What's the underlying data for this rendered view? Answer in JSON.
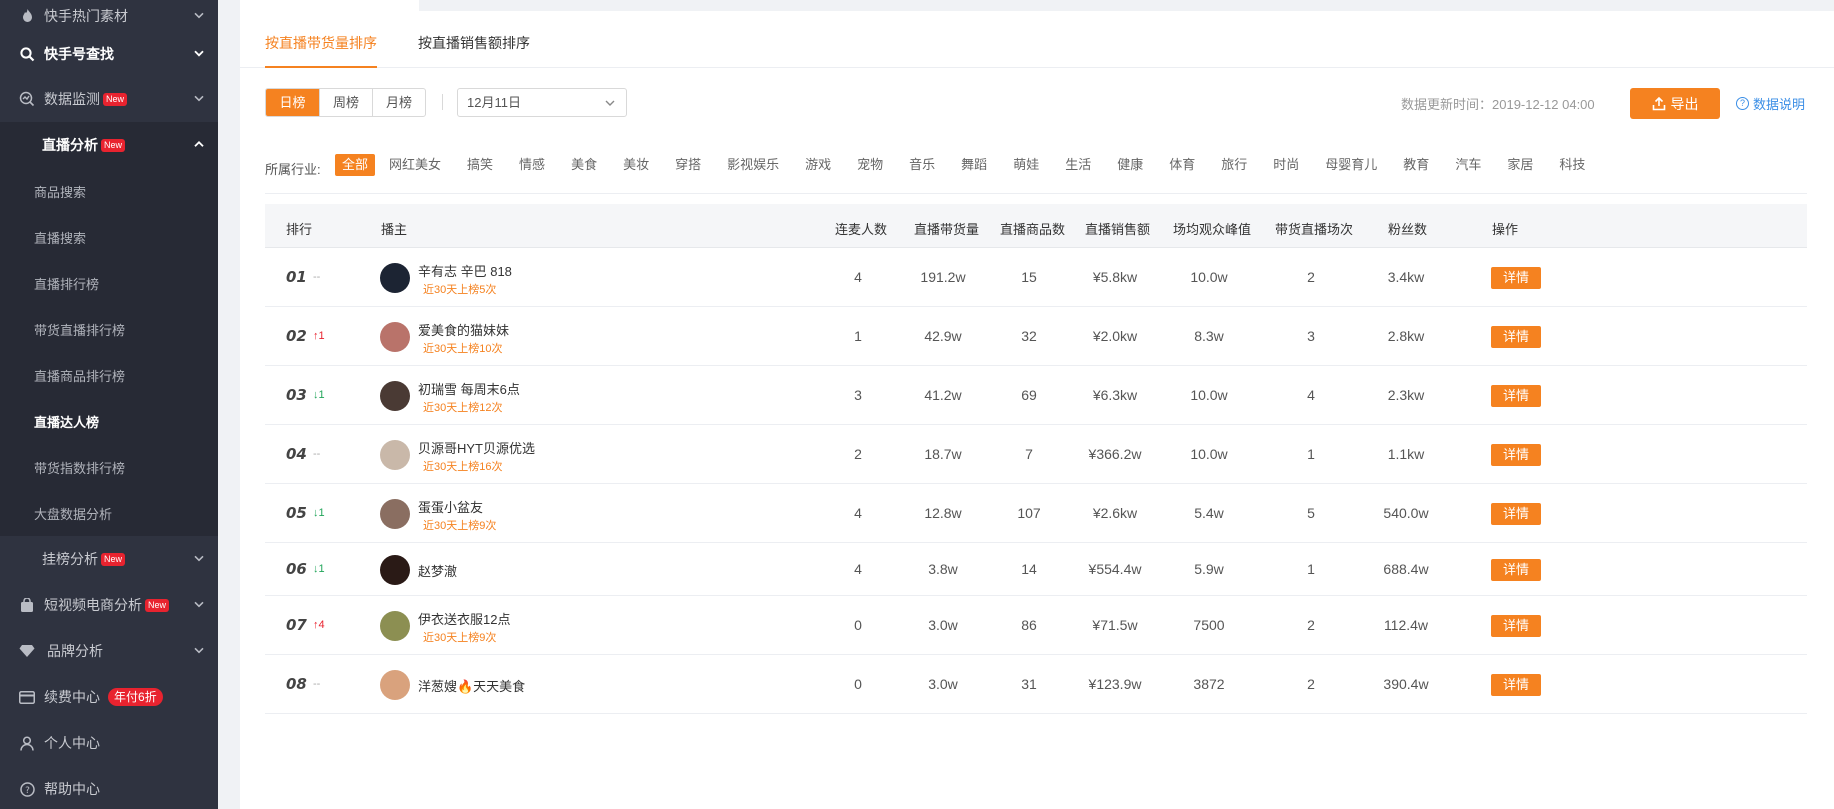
{
  "sidebar": {
    "items": [
      {
        "label": "快手热门素材",
        "icon": "flame-icon"
      },
      {
        "label": "快手号查找",
        "icon": "search-icon"
      },
      {
        "label": "数据监测",
        "icon": "monitor-icon",
        "badge": "New"
      },
      {
        "label": "直播分析",
        "badge": "New"
      },
      {
        "label": "商品搜索"
      },
      {
        "label": "直播搜索"
      },
      {
        "label": "直播排行榜"
      },
      {
        "label": "带货直播排行榜"
      },
      {
        "label": "直播商品排行榜"
      },
      {
        "label": "直播达人榜"
      },
      {
        "label": "带货指数排行榜"
      },
      {
        "label": "大盘数据分析"
      },
      {
        "label": "挂榜分析",
        "badge": "New"
      },
      {
        "label": "短视频电商分析",
        "icon": "bag-icon",
        "badge": "New"
      },
      {
        "label": "品牌分析",
        "icon": "diamond-icon"
      },
      {
        "label": "续费中心",
        "icon": "card-icon",
        "promo": "年付6折"
      },
      {
        "label": "个人中心",
        "icon": "user-icon"
      },
      {
        "label": "帮助中心",
        "icon": "help-icon"
      }
    ]
  },
  "tabs": [
    "按直播带货量排序",
    "按直播销售额排序"
  ],
  "period": {
    "options": [
      "日榜",
      "周榜",
      "月榜"
    ],
    "selected": "日榜"
  },
  "date_select": {
    "value": "12月11日"
  },
  "update_time": "数据更新时间：2019-12-12 04:00",
  "export_label": "导出",
  "help_label": "数据说明",
  "industry": {
    "label": "所属行业:",
    "options": [
      "全部",
      "网红美女",
      "搞笑",
      "情感",
      "美食",
      "美妆",
      "穿搭",
      "影视娱乐",
      "游戏",
      "宠物",
      "音乐",
      "舞蹈",
      "萌娃",
      "生活",
      "健康",
      "体育",
      "旅行",
      "时尚",
      "母婴育儿",
      "教育",
      "汽车",
      "家居",
      "科技"
    ],
    "selected": "全部"
  },
  "table": {
    "headers": [
      "排行",
      "播主",
      "连麦人数",
      "直播带货量",
      "直播商品数",
      "直播销售额",
      "场均观众峰值",
      "带货直播场次",
      "粉丝数",
      "操作"
    ],
    "action_label": "详情",
    "rows": [
      {
        "rank": "01",
        "trend": "--",
        "trend_dir": "flat",
        "name": "辛有志 辛巴 818",
        "note": "近30天上榜5次",
        "lianmai": "4",
        "volume": "191.2w",
        "goods": "15",
        "sales": "¥5.8kw",
        "peak": "10.0w",
        "sessions": "2",
        "fans": "3.4kw",
        "avatar_color": "#1c2433"
      },
      {
        "rank": "02",
        "trend": "↑1",
        "trend_dir": "up",
        "name": "爱美食的猫妹妹",
        "note": "近30天上榜10次",
        "lianmai": "1",
        "volume": "42.9w",
        "goods": "32",
        "sales": "¥2.0kw",
        "peak": "8.3w",
        "sessions": "3",
        "fans": "2.8kw",
        "avatar_color": "#b9736a"
      },
      {
        "rank": "03",
        "trend": "↓1",
        "trend_dir": "down",
        "name": "初瑞雪 每周末6点",
        "note": "近30天上榜12次",
        "lianmai": "3",
        "volume": "41.2w",
        "goods": "69",
        "sales": "¥6.3kw",
        "peak": "10.0w",
        "sessions": "4",
        "fans": "2.3kw",
        "avatar_color": "#4a3a34"
      },
      {
        "rank": "04",
        "trend": "--",
        "trend_dir": "flat",
        "name": "贝源哥HYT贝源优选",
        "note": "近30天上榜16次",
        "lianmai": "2",
        "volume": "18.7w",
        "goods": "7",
        "sales": "¥366.2w",
        "peak": "10.0w",
        "sessions": "1",
        "fans": "1.1kw",
        "avatar_color": "#c9b8a9"
      },
      {
        "rank": "05",
        "trend": "↓1",
        "trend_dir": "down",
        "name": "蛋蛋小盆友",
        "note": "近30天上榜9次",
        "lianmai": "4",
        "volume": "12.8w",
        "goods": "107",
        "sales": "¥2.6kw",
        "peak": "5.4w",
        "sessions": "5",
        "fans": "540.0w",
        "avatar_color": "#8a6e61"
      },
      {
        "rank": "06",
        "trend": "↓1",
        "trend_dir": "down",
        "name": "赵梦澈",
        "note": "",
        "lianmai": "4",
        "volume": "3.8w",
        "goods": "14",
        "sales": "¥554.4w",
        "peak": "5.9w",
        "sessions": "1",
        "fans": "688.4w",
        "avatar_color": "#2a1a16"
      },
      {
        "rank": "07",
        "trend": "↑4",
        "trend_dir": "up",
        "name": "伊衣送衣服12点",
        "note": "近30天上榜9次",
        "lianmai": "0",
        "volume": "3.0w",
        "goods": "86",
        "sales": "¥71.5w",
        "peak": "7500",
        "sessions": "2",
        "fans": "112.4w",
        "avatar_color": "#8c8f52"
      },
      {
        "rank": "08",
        "trend": "--",
        "trend_dir": "flat",
        "name": "洋葱嫂🔥天天美食",
        "note": "",
        "lianmai": "0",
        "volume": "3.0w",
        "goods": "31",
        "sales": "¥123.9w",
        "peak": "3872",
        "sessions": "2",
        "fans": "390.4w",
        "avatar_color": "#d9a27d"
      }
    ]
  },
  "colors": {
    "accent": "#f58220",
    "sidebar_bg": "#2f3340",
    "badge_red": "#e8232f",
    "up": "#e8232f",
    "down": "#22a55a"
  }
}
